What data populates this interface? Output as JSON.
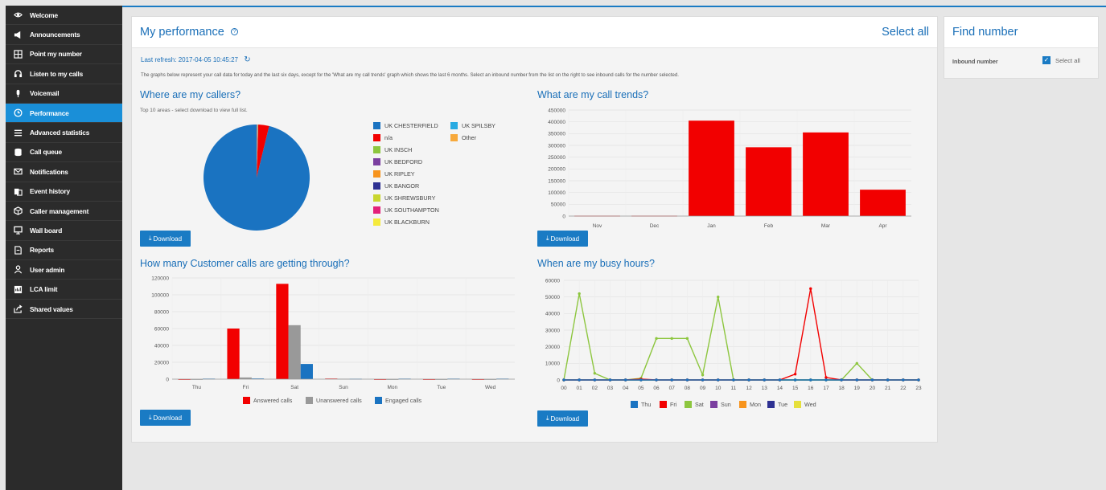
{
  "sidebar": {
    "items": [
      {
        "label": "Welcome",
        "icon": "eye-icon",
        "active": false
      },
      {
        "label": "Announcements",
        "icon": "megaphone-icon",
        "active": false
      },
      {
        "label": "Point my number",
        "icon": "grid-icon",
        "active": false
      },
      {
        "label": "Listen to my calls",
        "icon": "headset-icon",
        "active": false
      },
      {
        "label": "Voicemail",
        "icon": "microphone-icon",
        "active": false
      },
      {
        "label": "Performance",
        "icon": "clock-icon",
        "active": true
      },
      {
        "label": "Advanced statistics",
        "icon": "list-icon",
        "active": false
      },
      {
        "label": "Call queue",
        "icon": "database-icon",
        "active": false
      },
      {
        "label": "Notifications",
        "icon": "envelope-icon",
        "active": false
      },
      {
        "label": "Event history",
        "icon": "history-icon",
        "active": false
      },
      {
        "label": "Caller management",
        "icon": "cube-icon",
        "active": false
      },
      {
        "label": "Wall board",
        "icon": "monitor-icon",
        "active": false
      },
      {
        "label": "Reports",
        "icon": "document-icon",
        "active": false
      },
      {
        "label": "User admin",
        "icon": "user-icon",
        "active": false
      },
      {
        "label": "LCA limit",
        "icon": "gauge-icon",
        "active": false
      },
      {
        "label": "Shared values",
        "icon": "share-icon",
        "active": false
      }
    ]
  },
  "performance": {
    "title": "My performance",
    "help_glyph": "?",
    "select_all": "Select all",
    "last_refresh": "Last refresh: 2017-04-05 10:45:27",
    "intro": "The graphs below represent your call data for today and the last six days, except for the 'What are my call trends' graph which shows the last 6 months. Select an inbound number from the list on the right to see inbound calls for the number selected.",
    "download_label": "Download"
  },
  "find_number": {
    "title": "Find number",
    "inbound_label": "Inbound number",
    "select_all": "Select all",
    "checked": true
  },
  "colors": {
    "blue": "#1a73c1",
    "red": "#f20000",
    "green": "#8dc63f",
    "purple": "#7b3fa0",
    "orange": "#f7941d",
    "navy": "#2e3192",
    "yellow": "#e6e03c",
    "lightblue": "#29abe2",
    "gray": "#999999",
    "accent": "#1a7bc4"
  },
  "callers": {
    "title": "Where are my callers?",
    "subtitle": "Top 10 areas - select download to view full list.",
    "legend": [
      {
        "label": "UK CHESTERFIELD",
        "color": "#1a73c1"
      },
      {
        "label": "UK SPILSBY",
        "color": "#29abe2"
      },
      {
        "label": "n/a",
        "color": "#f20000"
      },
      {
        "label": "Other",
        "color": "#f7a93b"
      },
      {
        "label": "UK INSCH",
        "color": "#8dc63f"
      },
      {
        "label": "UK BEDFORD",
        "color": "#7b3fa0"
      },
      {
        "label": "UK RIPLEY",
        "color": "#f7941d"
      },
      {
        "label": "UK BANGOR",
        "color": "#2e3192"
      },
      {
        "label": "UK SHREWSBURY",
        "color": "#c9d62f"
      },
      {
        "label": "UK SOUTHAMPTON",
        "color": "#e3217a"
      },
      {
        "label": "UK BLACKBURN",
        "color": "#f5ea3c"
      }
    ]
  },
  "trends": {
    "title": "What are my call trends?"
  },
  "through": {
    "title": "How many Customer calls are getting through?"
  },
  "busy": {
    "title": "When are my busy hours?"
  },
  "chart_data": [
    {
      "type": "pie",
      "title": "Where are my callers?",
      "labels": [
        "UK CHESTERFIELD",
        "n/a",
        "UK SPILSBY",
        "Other",
        "UK INSCH",
        "UK BEDFORD",
        "UK RIPLEY",
        "UK BANGOR",
        "UK SHREWSBURY",
        "UK SOUTHAMPTON",
        "UK BLACKBURN"
      ],
      "values": [
        96.2,
        3.3,
        0.1,
        0.1,
        0.05,
        0.05,
        0.05,
        0.05,
        0.05,
        0.05,
        0.0
      ],
      "colors": [
        "#1a73c1",
        "#f20000",
        "#29abe2",
        "#f7a93b",
        "#8dc63f",
        "#7b3fa0",
        "#f7941d",
        "#2e3192",
        "#c9d62f",
        "#e3217a",
        "#f5ea3c"
      ]
    },
    {
      "type": "bar",
      "title": "What are my call trends?",
      "categories": [
        "Nov",
        "Dec",
        "Jan",
        "Feb",
        "Mar",
        "Apr"
      ],
      "values": [
        1500,
        1500,
        405000,
        292000,
        355000,
        112000
      ],
      "ylim": [
        0,
        450000
      ],
      "yticks": [
        "0",
        "50000",
        "100000",
        "150000",
        "200000",
        "250000",
        "300000",
        "350000",
        "400000",
        "450000"
      ],
      "color": "#f20000",
      "grid": true
    },
    {
      "type": "bar",
      "title": "How many Customer calls are getting through?",
      "categories": [
        "Thu",
        "Fri",
        "Sat",
        "Sun",
        "Mon",
        "Tue",
        "Wed"
      ],
      "series": [
        {
          "name": "Answered calls",
          "color": "#f20000",
          "values": [
            0,
            60000,
            113000,
            700,
            0,
            0,
            0
          ]
        },
        {
          "name": "Unanswered calls",
          "color": "#999999",
          "values": [
            0,
            2000,
            64000,
            500,
            0,
            0,
            0
          ]
        },
        {
          "name": "Engaged calls",
          "color": "#1a73c1",
          "values": [
            600,
            800,
            18000,
            500,
            600,
            600,
            600
          ]
        }
      ],
      "ylim": [
        0,
        120000
      ],
      "yticks": [
        "0",
        "20000",
        "40000",
        "60000",
        "80000",
        "100000",
        "120000"
      ],
      "legend": "bottom",
      "grid": true
    },
    {
      "type": "line",
      "title": "When are my busy hours?",
      "x": [
        "00",
        "01",
        "02",
        "03",
        "04",
        "05",
        "06",
        "07",
        "08",
        "09",
        "10",
        "11",
        "12",
        "13",
        "14",
        "15",
        "16",
        "17",
        "18",
        "19",
        "20",
        "21",
        "22",
        "23"
      ],
      "series": [
        {
          "name": "Thu",
          "color": "#1a73c1",
          "values": [
            0,
            0,
            0,
            0,
            0,
            0,
            0,
            0,
            0,
            0,
            0,
            0,
            0,
            0,
            0,
            0,
            0,
            0,
            0,
            0,
            0,
            0,
            0,
            0
          ]
        },
        {
          "name": "Fri",
          "color": "#f20000",
          "values": [
            0,
            0,
            0,
            0,
            0,
            500,
            0,
            0,
            0,
            0,
            0,
            0,
            0,
            0,
            0,
            3500,
            55000,
            1500,
            0,
            0,
            0,
            0,
            0,
            0
          ]
        },
        {
          "name": "Sat",
          "color": "#8dc63f",
          "values": [
            0,
            52000,
            4000,
            0,
            0,
            1000,
            25000,
            25000,
            25000,
            3000,
            50000,
            0,
            0,
            0,
            0,
            0,
            0,
            0,
            0,
            10000,
            0,
            0,
            0,
            0
          ]
        },
        {
          "name": "Sun",
          "color": "#7b3fa0",
          "values": [
            0,
            0,
            0,
            0,
            0,
            0,
            0,
            0,
            0,
            0,
            0,
            0,
            0,
            0,
            0,
            0,
            0,
            0,
            0,
            0,
            0,
            0,
            0,
            0
          ]
        },
        {
          "name": "Mon",
          "color": "#f7941d",
          "values": [
            0,
            0,
            0,
            0,
            0,
            0,
            0,
            0,
            0,
            0,
            0,
            0,
            0,
            0,
            0,
            0,
            0,
            0,
            0,
            0,
            0,
            0,
            0,
            0
          ]
        },
        {
          "name": "Tue",
          "color": "#2e3192",
          "values": [
            0,
            0,
            0,
            0,
            0,
            0,
            0,
            0,
            0,
            0,
            0,
            0,
            0,
            0,
            0,
            0,
            0,
            0,
            0,
            0,
            0,
            0,
            0,
            0
          ]
        },
        {
          "name": "Wed",
          "color": "#e6e03c",
          "values": [
            0,
            0,
            0,
            0,
            0,
            0,
            0,
            0,
            0,
            0,
            0,
            0,
            0,
            0,
            0,
            0,
            0,
            0,
            0,
            0,
            0,
            0,
            0,
            0
          ]
        }
      ],
      "ylim": [
        0,
        60000
      ],
      "yticks": [
        "0",
        "10000",
        "20000",
        "30000",
        "40000",
        "50000",
        "60000"
      ],
      "legend": "bottom",
      "grid": true
    }
  ]
}
